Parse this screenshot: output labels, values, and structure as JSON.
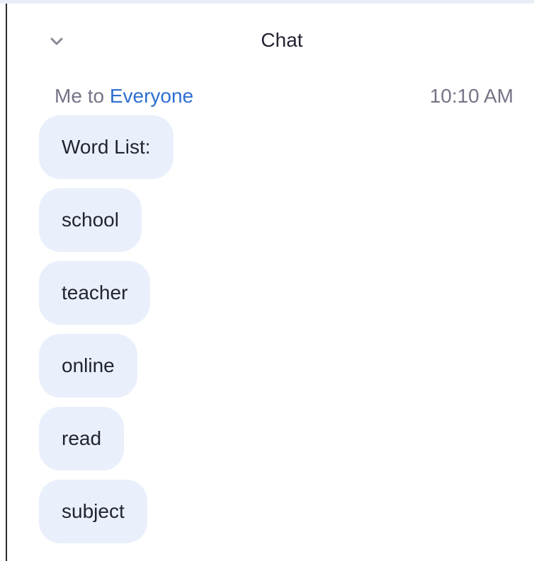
{
  "header": {
    "collapse_icon": "chevron-down-icon",
    "title": "Chat"
  },
  "message_group": {
    "sender": "Me",
    "to_word": "to",
    "recipient": "Everyone",
    "timestamp": "10:10 AM",
    "messages": [
      "Word List:",
      "school",
      "teacher",
      "online",
      "read",
      "subject"
    ]
  },
  "colors": {
    "bubble_bg": "#e9f0fb",
    "recipient_link": "#2d6fd1",
    "meta_text": "#747487",
    "primary_text": "#232333"
  }
}
